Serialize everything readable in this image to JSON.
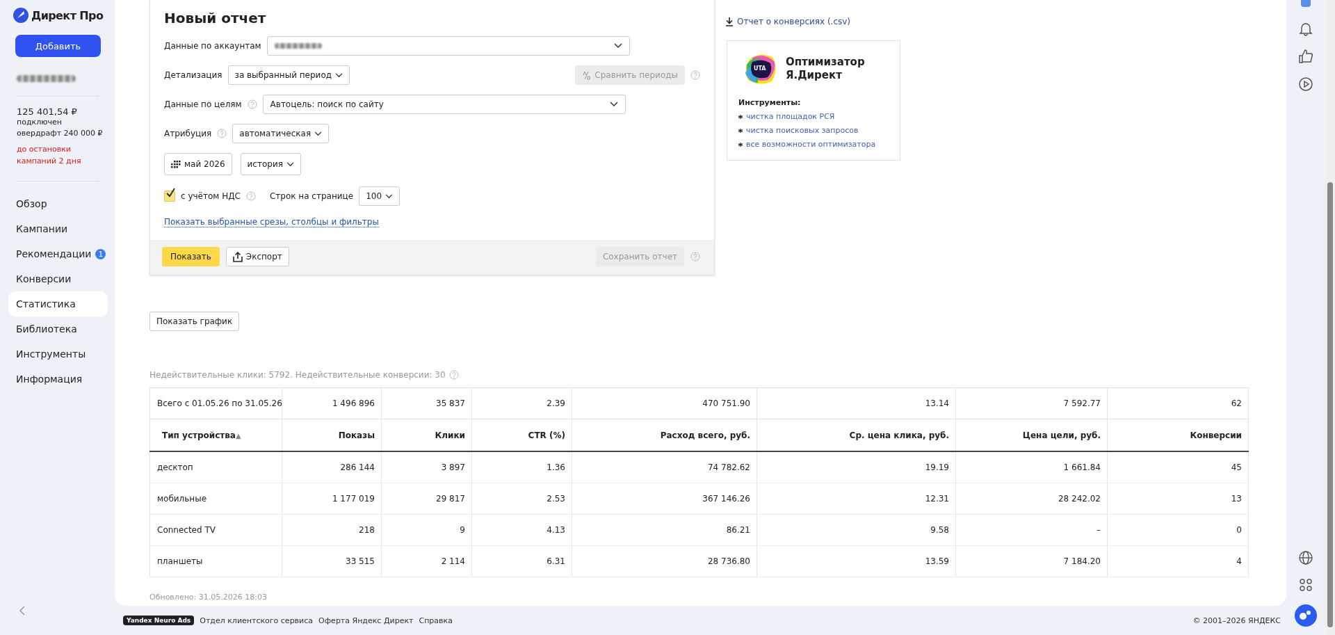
{
  "sidebar": {
    "logo": "Директ Про",
    "add_button": "Добавить",
    "balance": "125 401,54 ₽",
    "overdraft_lines": [
      "подключен",
      "овердрафт 240 000 ₽"
    ],
    "warning": "до остановки кампаний 2 дня",
    "items": [
      {
        "label": "Обзор",
        "selected": false
      },
      {
        "label": "Кампании",
        "selected": false
      },
      {
        "label": "Рекомендации",
        "selected": false,
        "badge": "1"
      },
      {
        "label": "Конверсии",
        "selected": false
      },
      {
        "label": "Статистика",
        "selected": true
      },
      {
        "label": "Библиотека",
        "selected": false
      },
      {
        "label": "Инструменты",
        "selected": false
      },
      {
        "label": "Информация",
        "selected": false
      }
    ]
  },
  "report": {
    "title": "Новый отчет",
    "accounts_label": "Данные по аккаунтам",
    "detail_label": "Детализация",
    "detail_value": "за выбранный период",
    "compare_button": {
      "label": "Сравнить периоды",
      "disabled": true
    },
    "goals_label": "Данные по целям",
    "goals_value": "Автоцель: поиск по сайту",
    "attribution_label": "Атрибуция",
    "attribution_value": "автоматическая",
    "period": "май 2026",
    "history": "история",
    "vat": {
      "label": "с учётом НДС",
      "checked": true
    },
    "rows_label": "Строк на странице",
    "rows_value": "100",
    "slices_link": "Показать выбранные срезы, столбцы и фильтры",
    "show_button": "Показать",
    "export_button": "Экспорт",
    "save_button": {
      "label": "Сохранить отчет",
      "disabled": true
    }
  },
  "csv_link": "Отчет о конверсиях (.csv)",
  "promo": {
    "logo_text": "UTA",
    "title_lines": [
      "Оптимизатор",
      "Я.Директ"
    ],
    "tools_label": "Инструменты:",
    "links": [
      "чистка площадок РСЯ",
      "чистка поисковых запросов",
      "все возможности оптимизатора"
    ]
  },
  "chart_button": "Показать график",
  "invalid_note": "Недействительные клики: 5792. Недействительные конверсии: 30",
  "table": {
    "totals": [
      "Всего с 01.05.26 по 31.05.26",
      "1 496 896",
      "35 837",
      "2.39",
      "470 751.90",
      "13.14",
      "7 592.77",
      "62"
    ],
    "columns": [
      "Тип устройства",
      "Показы",
      "Клики",
      "CTR (%)",
      "Расход всего, руб.",
      "Ср. цена клика, руб.",
      "Цена цели, руб.",
      "Конверсии"
    ],
    "sort_mark": "▲",
    "rows": [
      [
        "десктоп",
        "286 144",
        "3 897",
        "1.36",
        "74 782.62",
        "19.19",
        "1 661.84",
        "45"
      ],
      [
        "мобильные",
        "1 177 019",
        "29 817",
        "2.53",
        "367 146.26",
        "12.31",
        "28 242.02",
        "13"
      ],
      [
        "Connected TV",
        "218",
        "9",
        "4.13",
        "86.21",
        "9.58",
        "–",
        "0"
      ],
      [
        "планшеты",
        "33 515",
        "2 114",
        "6.31",
        "28 736.80",
        "13.59",
        "7 184.20",
        "4"
      ]
    ]
  },
  "updated": "Обновлено: 31.05.2026 18:03",
  "footer": {
    "badge": "Yandex Neuro Ads",
    "links": [
      "Отдел клиентского сервиса",
      "Оферта Яндекс Директ",
      "Справка"
    ],
    "copyright": "© 2001–2026 ЯНДЕКС"
  }
}
